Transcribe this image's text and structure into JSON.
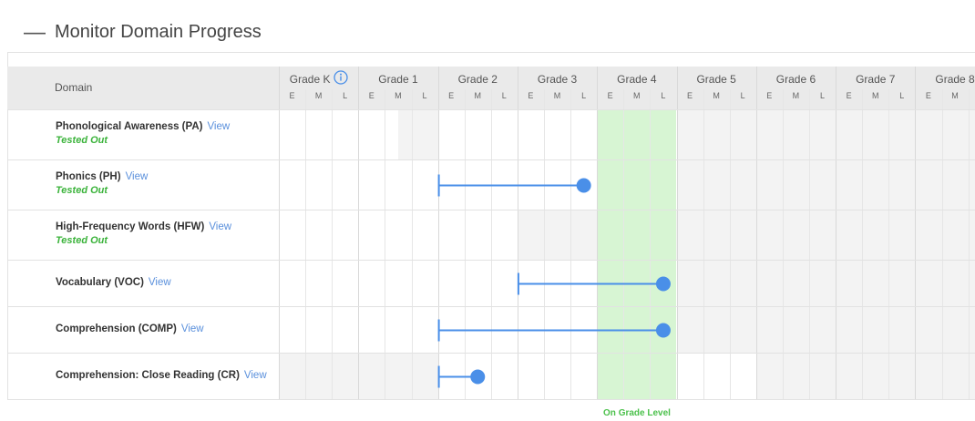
{
  "header": {
    "title": "Monitor Domain Progress",
    "collapse_symbol": "—"
  },
  "table": {
    "domain_header": "Domain",
    "grades": [
      "Grade K",
      "Grade 1",
      "Grade 2",
      "Grade 3",
      "Grade 4",
      "Grade 5",
      "Grade 6",
      "Grade 7",
      "Grade 8"
    ],
    "sub_labels": [
      "E",
      "M",
      "L"
    ],
    "on_grade_label": "On Grade Level",
    "view_label": "View",
    "rows": [
      {
        "label": "Phonological Awareness (PA)",
        "view": "View",
        "status": "Tested Out"
      },
      {
        "label": "Phonics (PH)",
        "view": "View",
        "status": "Tested Out"
      },
      {
        "label": "High-Frequency Words (HFW)",
        "view": "View",
        "status": "Tested Out"
      },
      {
        "label": "Vocabulary (VOC)",
        "view": "View",
        "status": ""
      },
      {
        "label": "Comprehension (COMP)",
        "view": "View",
        "status": ""
      },
      {
        "label": "Comprehension: Close Reading (CR)",
        "view": "View",
        "status": ""
      }
    ]
  },
  "progress": [
    {
      "domain": "Phonics (PH)",
      "start_grade": "Grade 2",
      "start_period": "E",
      "end_grade": "Grade 3",
      "end_period": "L"
    },
    {
      "domain": "Vocabulary (VOC)",
      "start_grade": "Grade 3",
      "start_period": "E",
      "end_grade": "Grade 4",
      "end_period": "L"
    },
    {
      "domain": "Comprehension (COMP)",
      "start_grade": "Grade 2",
      "start_period": "E",
      "end_grade": "Grade 4",
      "end_period": "L"
    },
    {
      "domain": "Comprehension: Close Reading (CR)",
      "start_grade": "Grade 2",
      "start_period": "E",
      "end_grade": "Grade 2",
      "end_period": "M"
    }
  ],
  "on_grade": "Grade 4",
  "colors": {
    "progress_line": "#4a8fe8",
    "on_grade_fill": "#d7f5d3",
    "tested_out": "#3bb33b",
    "view_link": "#5a90dc"
  }
}
